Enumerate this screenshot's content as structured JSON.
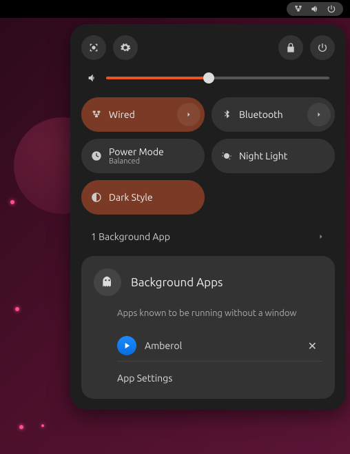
{
  "volume": {
    "percent": 46
  },
  "toggles": {
    "wired": {
      "label": "Wired",
      "active": true
    },
    "bluetooth": {
      "label": "Bluetooth",
      "active": false
    },
    "power_mode": {
      "label": "Power Mode",
      "sub": "Balanced",
      "active": false
    },
    "night_light": {
      "label": "Night Light",
      "active": false
    },
    "dark_style": {
      "label": "Dark Style",
      "active": true
    }
  },
  "background_apps": {
    "summary": "1 Background App",
    "title": "Background Apps",
    "description": "Apps known to be running without a window",
    "items": [
      {
        "name": "Amberol"
      }
    ],
    "settings_label": "App Settings"
  }
}
